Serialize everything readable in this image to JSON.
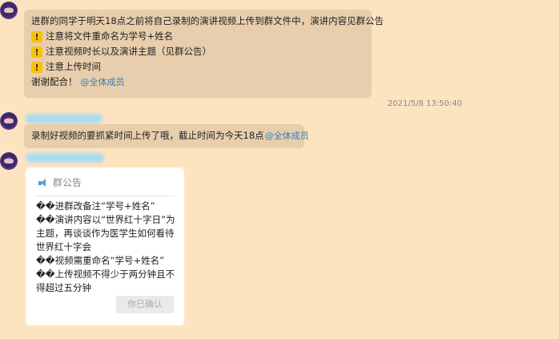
{
  "messages": [
    {
      "lines": [
        "进群的同学于明天18点之前将自己录制的演讲视频上传到群文件中，演讲内容见群公告",
        "注意将文件重命名为学号+姓名",
        "注意视频时长以及演讲主题（见群公告）",
        "注意上传时间",
        "谢谢配合！"
      ],
      "mention": "@全体成员"
    },
    {
      "text": "录制好视频的要抓紧时间上传了哦，截止时间为今天18点",
      "mention": "@全体成员"
    }
  ],
  "timestamp": "2021/5/8 13:50:40",
  "notice": {
    "title": "群公告",
    "body": "��进群改备注“学号+姓名”\n��演讲内容以“世界红十字日”为主题，再谈谈作为医学生如何看待世界红十字会\n��视频需重命名“学号+姓名”\n��上传视频不得少于两分钟且不得超过五分钟",
    "confirm_label": "你已确认"
  },
  "icons": {
    "warning": "warning-icon",
    "announcement": "speaker-icon"
  },
  "colors": {
    "background": "#fde4c0",
    "bubble": "#e8ceac",
    "mention": "#2f7fc0"
  }
}
